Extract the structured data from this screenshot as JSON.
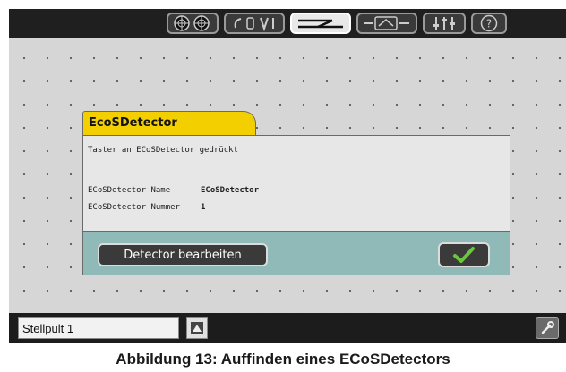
{
  "toolbar": {
    "icons": [
      "locomotives-icon",
      "keyboard-icon",
      "track-diagram-icon",
      "switches-icon",
      "settings-icon",
      "help-icon"
    ],
    "help_label": "?"
  },
  "dialog": {
    "title": "EcoSDetector",
    "message": "Taster an ECoSDetector gedrückt",
    "name_label": "ECoSDetector Name",
    "name_value": "ECoSDetector",
    "number_label": "ECoSDetector Nummer",
    "number_value": "1",
    "edit_button": "Detector bearbeiten"
  },
  "bottombar": {
    "panel_name": "Stellpult 1"
  },
  "caption": "Abbildung 13: Auffinden eines ECoSDetectors",
  "colors": {
    "tab_yellow": "#f3cf00",
    "footer_teal": "#8fbab8",
    "confirm_green": "#6ac63a"
  }
}
